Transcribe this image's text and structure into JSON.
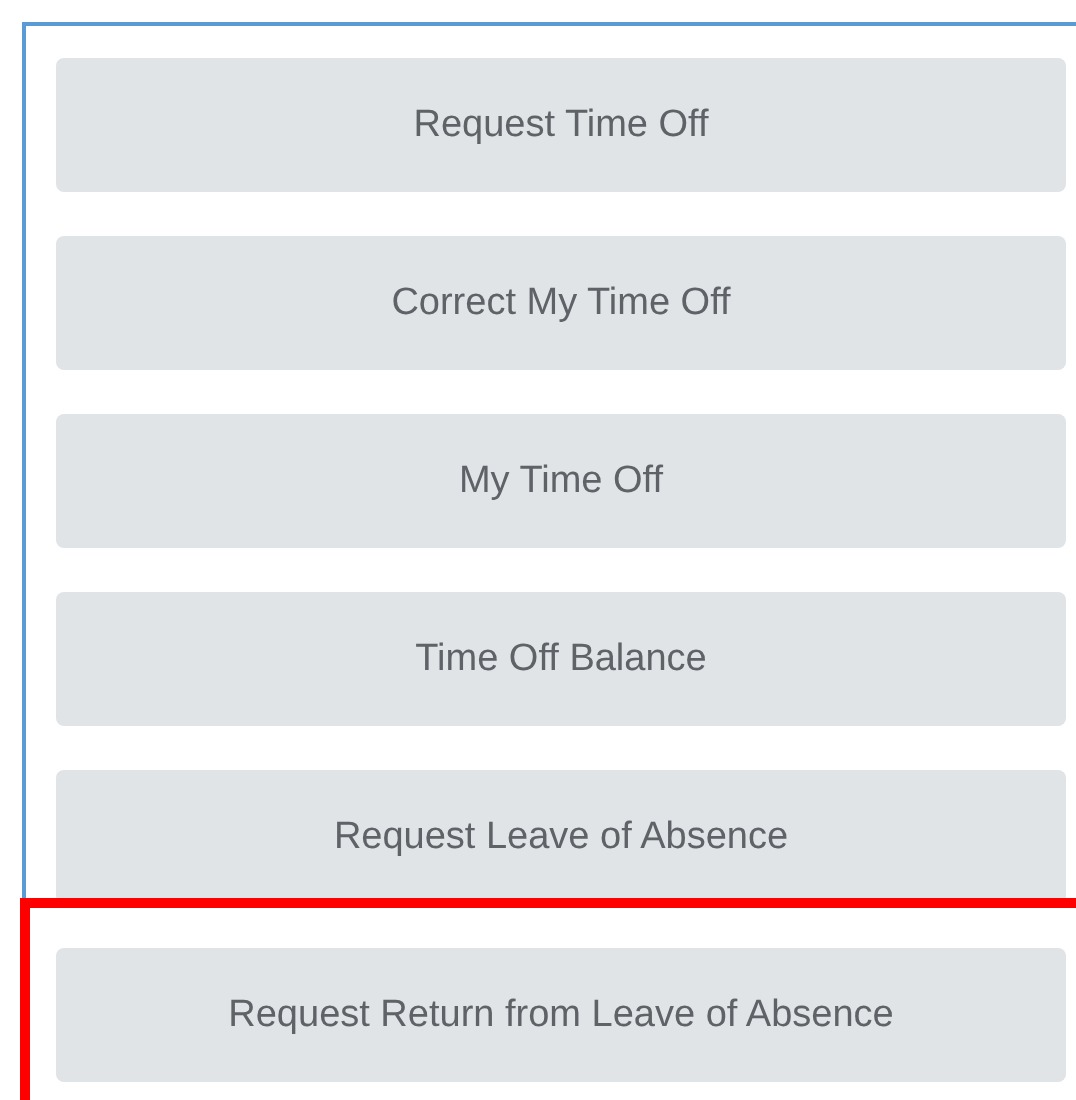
{
  "buttons": [
    {
      "label": "Request Time Off",
      "highlighted": false
    },
    {
      "label": "Correct My Time Off",
      "highlighted": false
    },
    {
      "label": "My Time Off",
      "highlighted": false
    },
    {
      "label": "Time Off Balance",
      "highlighted": false
    },
    {
      "label": "Request Leave of Absence",
      "highlighted": false
    },
    {
      "label": "Request Return from Leave of Absence",
      "highlighted": true
    }
  ]
}
